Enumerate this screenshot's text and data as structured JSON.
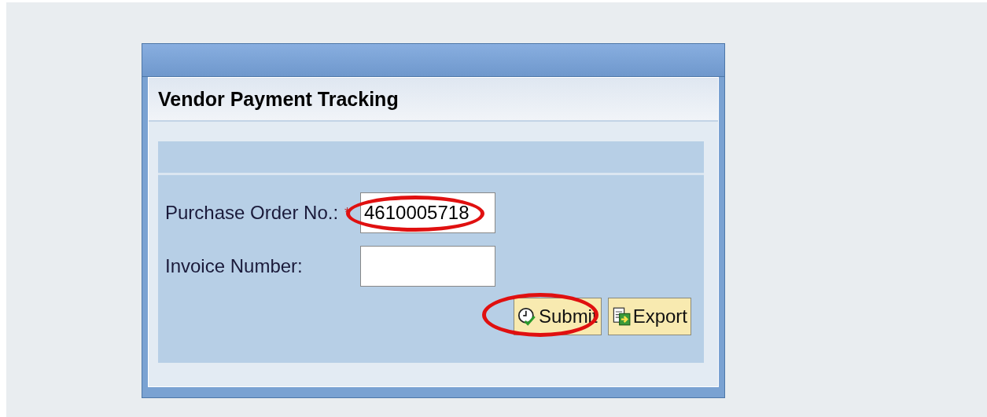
{
  "panel": {
    "title": "Vendor Payment Tracking"
  },
  "fields": [
    {
      "label": "Purchase Order No.:",
      "required_mark": "*",
      "value": "4610005718",
      "highlighted": true
    },
    {
      "label": "Invoice Number:",
      "highlighted": false
    }
  ],
  "buttons": [
    {
      "label": "Submit",
      "kind": "submit",
      "highlighted": true
    },
    {
      "label": "Export",
      "kind": "export",
      "highlighted": false
    }
  ]
}
